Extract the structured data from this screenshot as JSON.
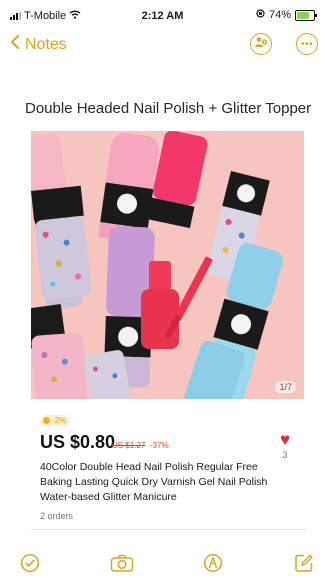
{
  "status_bar": {
    "carrier": "T-Mobile",
    "time": "2:12 AM",
    "battery_percent": "74%",
    "battery_level": 0.74
  },
  "nav": {
    "back_label": "Notes"
  },
  "note": {
    "title": "Double Headed Nail Polish + Glitter Topper"
  },
  "product": {
    "image_counter": "1/7",
    "coin_badge": "-2%",
    "price": "US $0.80",
    "old_price": "US $1.27",
    "discount": "-37%",
    "wishlist_count": "3",
    "description": "40Color Double Head Nail Polish Regular Free Baking Lasting Quick Dry Varnish Gel Nail Polish Water-based  Glitter Manicure",
    "orders": "2 orders"
  },
  "colors": {
    "accent": "#d9a520",
    "price_red": "#e0461c",
    "heart": "#e8233a"
  },
  "icons": {
    "nav": [
      "chevron-left-icon",
      "share-person-icon",
      "more-icon"
    ],
    "toolbar": [
      "checklist-icon",
      "camera-icon",
      "markup-pen-icon",
      "compose-icon"
    ]
  }
}
